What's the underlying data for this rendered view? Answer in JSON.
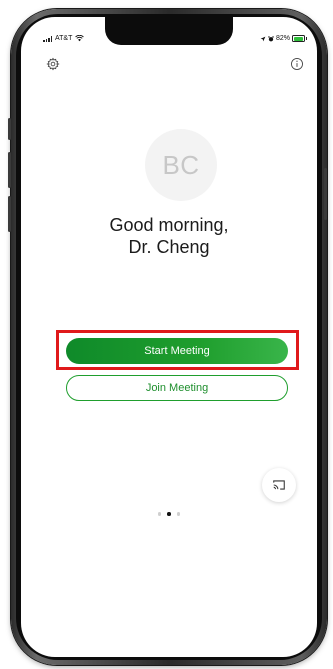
{
  "status_bar": {
    "carrier": "AT&T",
    "battery_percent": "82%",
    "battery_level": 0.82,
    "icons": [
      "signal-icon",
      "wifi-icon",
      "location-arrow-icon",
      "alarm-icon",
      "battery-icon"
    ]
  },
  "top_bar": {
    "left_icon": "gear-icon",
    "right_icon": "info-icon"
  },
  "profile": {
    "initials": "BC",
    "greeting_line1": "Good morning,",
    "greeting_line2": "Dr. Cheng"
  },
  "actions": {
    "start_meeting_label": "Start Meeting",
    "join_meeting_label": "Join Meeting"
  },
  "cast": {
    "icon": "cast-icon"
  },
  "pager": {
    "count": 3,
    "active_index": 1
  },
  "colors": {
    "accent_green": "#1f9e2d",
    "highlight_red": "#e0191b",
    "avatar_bg": "#f3f3f3"
  }
}
